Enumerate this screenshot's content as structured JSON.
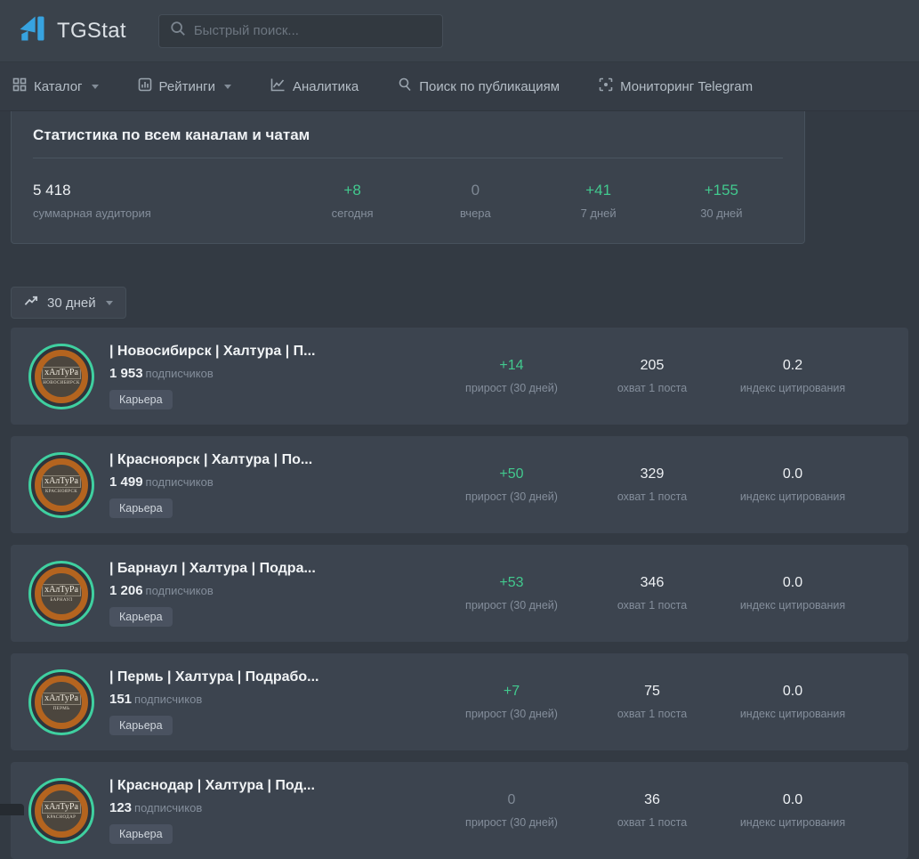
{
  "header": {
    "brand": "TGStat",
    "search_placeholder": "Быстрый поиск..."
  },
  "nav": {
    "items": [
      {
        "label": "Каталог",
        "icon": "grid-icon",
        "dropdown": true
      },
      {
        "label": "Рейтинги",
        "icon": "bar-chart-icon",
        "dropdown": true
      },
      {
        "label": "Аналитика",
        "icon": "line-chart-icon",
        "dropdown": false
      },
      {
        "label": "Поиск по публикациям",
        "icon": "search-icon",
        "dropdown": false
      },
      {
        "label": "Мониторинг Telegram",
        "icon": "scan-icon",
        "dropdown": false
      }
    ]
  },
  "summary_card": {
    "title": "Статистика по всем каналам и чатам",
    "stats": [
      {
        "value": "5 418",
        "label": "суммарная аудитория",
        "color": "white"
      },
      {
        "value": "+8",
        "label": "сегодня",
        "color": "green"
      },
      {
        "value": "0",
        "label": "вчера",
        "color": "muted"
      },
      {
        "value": "+41",
        "label": "7 дней",
        "color": "green"
      },
      {
        "value": "+155",
        "label": "30 дней",
        "color": "green"
      }
    ]
  },
  "period_button": {
    "label": "30 дней",
    "icon": "trending-up-icon"
  },
  "channels": [
    {
      "title": "| Новосибирск | Халтура | П...",
      "subscribers": "1 953",
      "subscribers_label": "подписчиков",
      "category": "Карьера",
      "avatar_line1": "хАлТуРа",
      "avatar_line2": "НОВОСИБИРСК",
      "stats": [
        {
          "value": "+14",
          "label": "прирост (30 дней)",
          "color": "green"
        },
        {
          "value": "205",
          "label": "охват 1 поста",
          "color": "white"
        },
        {
          "value": "0.2",
          "label": "индекс цитирования",
          "color": "white"
        }
      ]
    },
    {
      "title": "| Красноярск | Халтура | По...",
      "subscribers": "1 499",
      "subscribers_label": "подписчиков",
      "category": "Карьера",
      "avatar_line1": "хАлТуРа",
      "avatar_line2": "КРАСНОЯРСК",
      "stats": [
        {
          "value": "+50",
          "label": "прирост (30 дней)",
          "color": "green"
        },
        {
          "value": "329",
          "label": "охват 1 поста",
          "color": "white"
        },
        {
          "value": "0.0",
          "label": "индекс цитирования",
          "color": "white"
        }
      ]
    },
    {
      "title": "| Барнаул | Халтура | Подра...",
      "subscribers": "1 206",
      "subscribers_label": "подписчиков",
      "category": "Карьера",
      "avatar_line1": "хАлТуРа",
      "avatar_line2": "БАРНАУЛ",
      "stats": [
        {
          "value": "+53",
          "label": "прирост (30 дней)",
          "color": "green"
        },
        {
          "value": "346",
          "label": "охват 1 поста",
          "color": "white"
        },
        {
          "value": "0.0",
          "label": "индекс цитирования",
          "color": "white"
        }
      ]
    },
    {
      "title": "| Пермь | Халтура | Подрабо...",
      "subscribers": "151",
      "subscribers_label": "подписчиков",
      "category": "Карьера",
      "avatar_line1": "хАлТуРа",
      "avatar_line2": "ПЕРМЬ",
      "stats": [
        {
          "value": "+7",
          "label": "прирост (30 дней)",
          "color": "green"
        },
        {
          "value": "75",
          "label": "охват 1 поста",
          "color": "white"
        },
        {
          "value": "0.0",
          "label": "индекс цитирования",
          "color": "white"
        }
      ]
    },
    {
      "title": "| Краснодар | Халтура | Под...",
      "subscribers": "123",
      "subscribers_label": "подписчиков",
      "category": "Карьера",
      "avatar_line1": "хАлТуРа",
      "avatar_line2": "КРАСНОДАР",
      "stats": [
        {
          "value": "0",
          "label": "прирост (30 дней)",
          "color": "muted"
        },
        {
          "value": "36",
          "label": "охват 1 поста",
          "color": "white"
        },
        {
          "value": "0.0",
          "label": "индекс цитирования",
          "color": "white"
        }
      ]
    }
  ],
  "colors": {
    "accent_green": "#42c98e",
    "brand_blue": "#37a3e0",
    "avatar_ring_teal": "#3fd0a0",
    "avatar_ring_orange": "#b4641f",
    "header_bg": "#3a424b",
    "card_bg": "#3b434d",
    "row_bg": "#3c444f",
    "muted_text": "#848e9b"
  }
}
